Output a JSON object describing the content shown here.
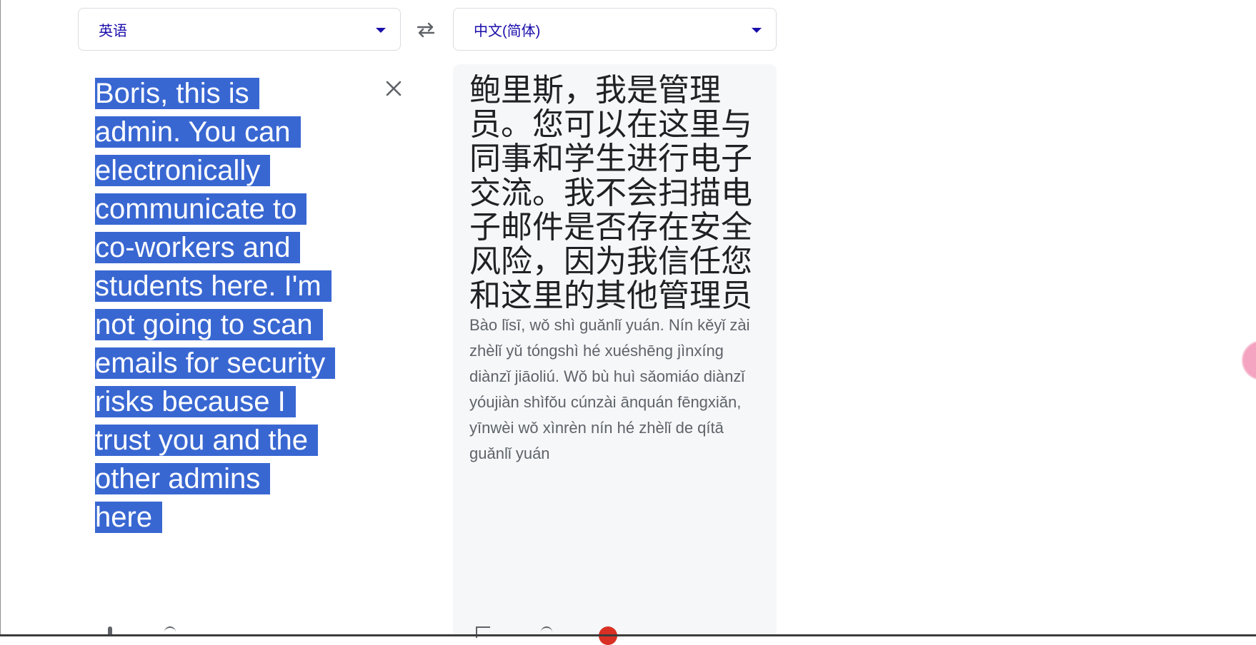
{
  "source_language": {
    "label": "英语"
  },
  "target_language": {
    "label": "中文(简体)"
  },
  "icons": {
    "swap": "swap-arrows-icon",
    "clear": "close-icon",
    "caret": "caret-down-icon",
    "microphone": "microphone-icon",
    "speaker": "speaker-icon",
    "copy": "copy-icon",
    "record": "record-dot-icon"
  },
  "source": {
    "text": "Boris, this is admin. You can electronically communicate to co-workers and students here. I'm not going to scan emails for security risks because I trust you and the other admins here",
    "selected": true
  },
  "target": {
    "text": "鲍里斯，我是管理员。您可以在这里与同事和学生进行电子交流。我不会扫描电子邮件是否存在安全风险，因为我信任您和这里的其他管理员",
    "romanization": "Bào lǐsī, wǒ shì guǎnlǐ yuán. Nín kěyǐ zài zhèlǐ yǔ tóngshì hé xuéshēng jìnxíng diànzǐ jiāoliú. Wǒ bù huì sǎomiáo diànzǐ yóujiàn shìfǒu cúnzài ānquán fēngxiǎn, yīnwèi wǒ xìnrèn nín hé zhèlǐ de qítā guǎnlǐ yuán"
  },
  "colors": {
    "selection": "#3967d2",
    "language_label": "#1a0dab",
    "target_background": "#f5f7f9"
  }
}
